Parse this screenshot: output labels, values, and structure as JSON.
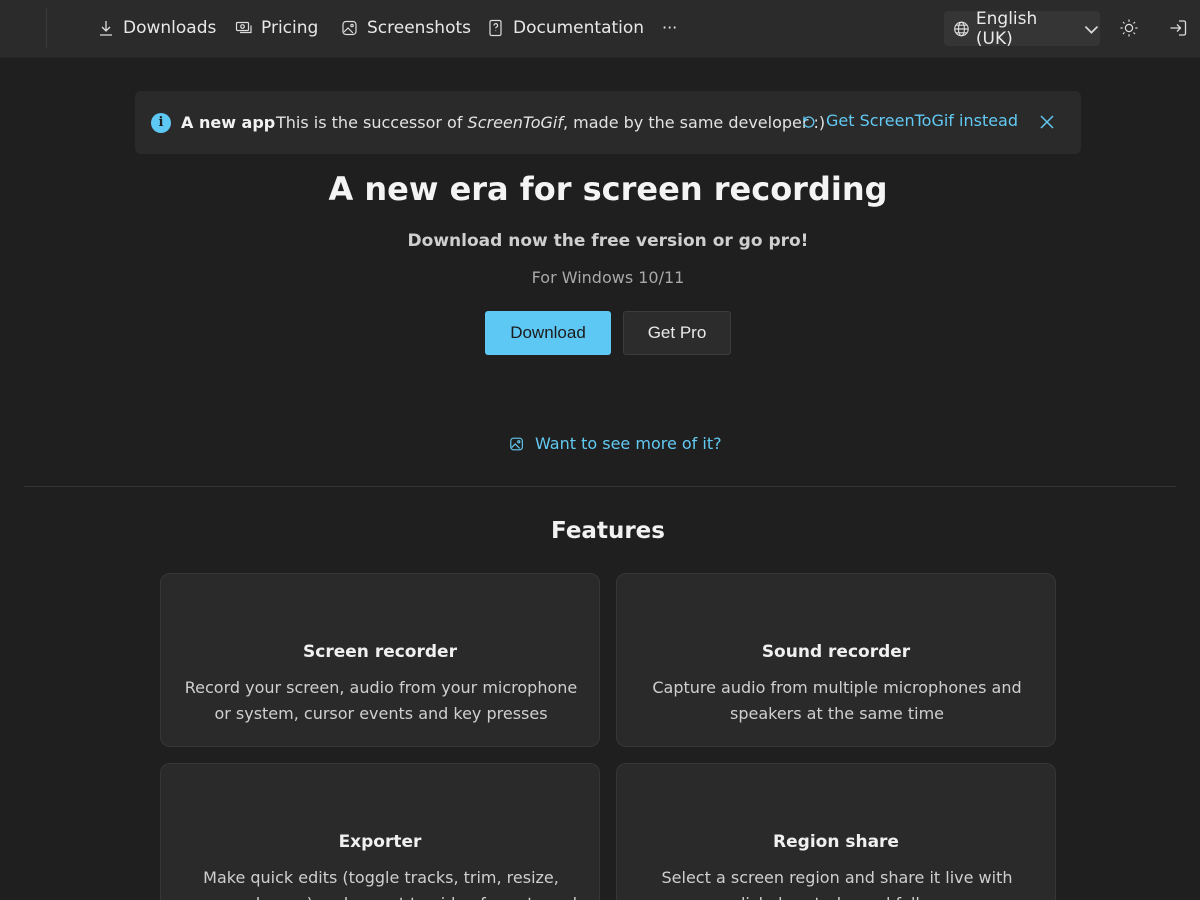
{
  "nav": {
    "items": [
      {
        "label": "Downloads",
        "icon": "download-icon"
      },
      {
        "label": "Pricing",
        "icon": "pricing-icon"
      },
      {
        "label": "Screenshots",
        "icon": "image-icon"
      },
      {
        "label": "Documentation",
        "icon": "docs-icon"
      }
    ],
    "more": "···",
    "language": "English (UK)"
  },
  "banner": {
    "title": "A new app",
    "text_before": "This is the successor of ",
    "text_italic": "ScreenToGif",
    "text_after": ", made by the same developer :)",
    "link": "Get ScreenToGif instead"
  },
  "hero": {
    "title": "A new era for screen recording",
    "subtitle": "Download now the free version or go pro!",
    "platform": "For Windows 10/11",
    "download_label": "Download",
    "pro_label": "Get Pro",
    "more_link": "Want to see more of it?"
  },
  "features": {
    "title": "Features",
    "cards": [
      {
        "title": "Screen recorder",
        "text": "Record your screen, audio from your microphone or system, cursor events and key presses"
      },
      {
        "title": "Sound recorder",
        "text": "Capture audio from multiple microphones and speakers at the same time"
      },
      {
        "title": "Exporter",
        "text": "Make quick edits (toggle tracks, trim, resize, crop, and more) and export to video formats and"
      },
      {
        "title": "Region share",
        "text": "Select a screen region and share it live with cursor, click, keystroke and follow-mouse tracking, plus"
      }
    ]
  },
  "colors": {
    "accent": "#5ec8f5",
    "background": "#1f1f1f",
    "surface": "#2a2a2a"
  }
}
